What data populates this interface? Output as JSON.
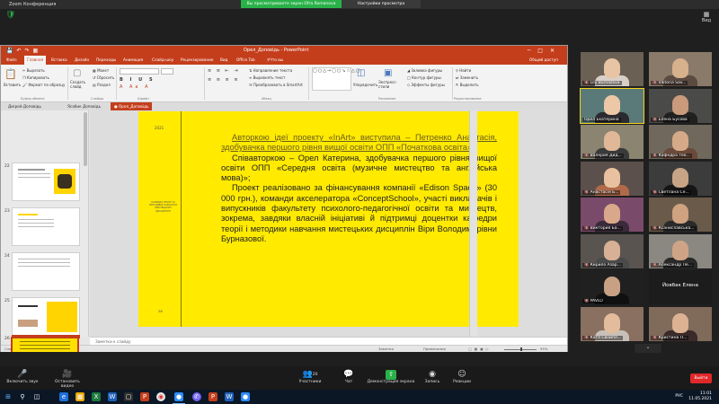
{
  "zoom": {
    "window_title": "Zoom Конференция",
    "share_banner": "Вы просматриваете экран Ofra Romanova",
    "view_options": "Настройки просмотра",
    "view_label": "Вид"
  },
  "ppt": {
    "title": "Орел_Доповідь - PowerPoint",
    "menu": [
      "Файл",
      "Главная",
      "Вставка",
      "Дизайн",
      "Переходы",
      "Анимация",
      "Слайд-шоу",
      "Рецензирование",
      "Вид",
      "Office Tab"
    ],
    "menu_active": "Главная",
    "tell_me": "Что вы хотите сделать?",
    "share": "Общий доступ",
    "ribbon": {
      "paste": "Вставить",
      "cut": "Вырезать",
      "copy": "Копировать",
      "format_painter": "Формат по образцу",
      "clipboard_group": "Буфер обмена",
      "new_slide": "Создать слайд",
      "layout": "Макет",
      "reset": "Сбросить",
      "section": "Раздел",
      "slides_group": "Слайды",
      "font_group": "Шрифт",
      "paragraph_group": "Абзац",
      "text_direction": "Направление текста",
      "align_text": "Выровнять текст",
      "smartart": "Преобразовать в SmartArt",
      "arrange": "Упорядочить",
      "quick_styles": "Экспресс-стили",
      "shape_fill": "Заливка фигуры",
      "shape_outline": "Контур фигуры",
      "shape_effects": "Эффекты фигуры",
      "drawing_group": "Рисование",
      "find": "Найти",
      "replace": "Заменить",
      "select": "Выделить",
      "editing_group": "Редактирование"
    },
    "tabs": [
      "Дмірей Доповідь",
      "Ясабик Доповідь",
      "Орел_Доповідь"
    ],
    "tab_active": "Орел_Доповідь",
    "thumbs": [
      {
        "num": "22",
        "style": "white"
      },
      {
        "num": "23",
        "style": "white"
      },
      {
        "num": "24",
        "style": "white"
      },
      {
        "num": "25",
        "style": "yellow"
      },
      {
        "num": "26",
        "style": "yellow-selected"
      }
    ],
    "slide": {
      "year": "2021",
      "small_text": "КАФЕДРА ТЕОРІЇ ТА МЕТОДИКИ НАВЧАННЯ МИСТЕЦЬКИХ ДИСЦИПЛІН",
      "page": "26",
      "paragraphs": [
        {
          "text": "Авторкою ідеї проекту «InArt» виступила – Петренко Анастасія, здобувачка першого рівня вищої освіти ОПП «Початкова освіта»;",
          "underline": true
        },
        {
          "text": "Співавторкою – Орел Катерина, здобувачка першого рівня вищої освіти ОПП «Середня освіта (музичне мистецтво та англійська мова)»;",
          "underline": false
        },
        {
          "text": "Проект реалізовано за фінансування компанії «Edison Space» (30 000 грн.), команди акселератора «ConceptSchool», участі викладачів і випускників факультету психолого-педагогічної освіти та мистецтв, зокрема, завдяки власній ініціативі й підтримці доцентки кафедри теорії і методики навчання мистецьких дисциплін Віри Володимирівни Бурназової.",
          "underline": false
        }
      ]
    },
    "notes_placeholder": "Заметки к слайду",
    "status": {
      "slide": "Слайд 26 из 26",
      "lang": "русский",
      "notes": "Заметки",
      "comments": "Примечания",
      "zoom": "55%"
    }
  },
  "gallery": [
    {
      "name": "Lily Burnazova",
      "mic_off": true,
      "bg": "#6b6054",
      "face": "#e6c4a4",
      "bodyc": "#d8d0c8"
    },
    {
      "name": "Viktoria Sav...",
      "mic_off": true,
      "bg": "#8a7a6a",
      "face": "#d7b08c",
      "bodyc": "#5a4a40"
    },
    {
      "name": "Орел Екатерина",
      "mic_off": false,
      "speaking": true,
      "bg": "#5a7a7a",
      "face": "#ecc8a6",
      "bodyc": "#2a2a30"
    },
    {
      "name": "Елена Бусова",
      "mic_off": true,
      "bg": "#4a4a48",
      "face": "#c99a7c",
      "bodyc": "#202020"
    },
    {
      "name": "Валерия Дид...",
      "mic_off": true,
      "bg": "#8a8470",
      "face": "#e0b898",
      "bodyc": "#3a3a3a"
    },
    {
      "name": "Кафедра тео...",
      "mic_off": true,
      "bg": "#70685c",
      "face": "#d6aa88",
      "bodyc": "#6a4a3a"
    },
    {
      "name": "Анастасія Б...",
      "mic_off": true,
      "bg": "#5c504c",
      "face": "#e8c2a0",
      "bodyc": "#b06a4a"
    },
    {
      "name": "Светлана Се...",
      "mic_off": true,
      "bg": "#3c3c3c",
      "face": "#c8a486",
      "bodyc": "#151515"
    },
    {
      "name": "Виктория Ба...",
      "mic_off": true,
      "bg": "#7a4a6a",
      "face": "#d9a88a",
      "bodyc": "#3a2a3a"
    },
    {
      "name": "Ксаниславська...",
      "mic_off": true,
      "bg": "#6a5a4a",
      "face": "#cfa280",
      "bodyc": "#2a2a2a"
    },
    {
      "name": "Кирило Азар...",
      "mic_off": true,
      "bg": "#5a5450",
      "face": "#d8b096",
      "bodyc": "#4a4a4a"
    },
    {
      "name": "Александр Пе...",
      "mic_off": true,
      "bg": "#8a8880",
      "face": "#cfa486",
      "bodyc": "#2a2a2a"
    },
    {
      "name": "PAVLO",
      "mic_off": true,
      "bg": "#202020",
      "face": "#c8a084",
      "bodyc": "#101010"
    },
    {
      "name": "Йовбак Елена",
      "mic_off": false,
      "blank": true,
      "bg": "#1c1c1c",
      "face": "#000",
      "bodyc": "#000"
    },
    {
      "name": "Катя Свнипл...",
      "mic_off": true,
      "bg": "#8a7060",
      "face": "#e2bc9c",
      "bodyc": "#c8c0b8"
    },
    {
      "name": "Кристина П...",
      "mic_off": true,
      "bg": "#806a5a",
      "face": "#dcb292",
      "bodyc": "#3a2a2a"
    }
  ],
  "toolbar": {
    "audio": "Включить звук",
    "video": "Остановить видео",
    "participants": "Участники",
    "participants_count": "20",
    "chat": "Чат",
    "share": "Демонстрация экрана",
    "record": "Запись",
    "reactions": "Реакции",
    "leave": "Выйти"
  },
  "tray": {
    "lang": "РУС",
    "time": "11:01",
    "date": "11.05.2021"
  },
  "colors": {
    "ppt_accent": "#c43e1c",
    "slide_bg": "#ffea00",
    "zoom_green": "#2ab24a",
    "leave_red": "#e02828"
  }
}
